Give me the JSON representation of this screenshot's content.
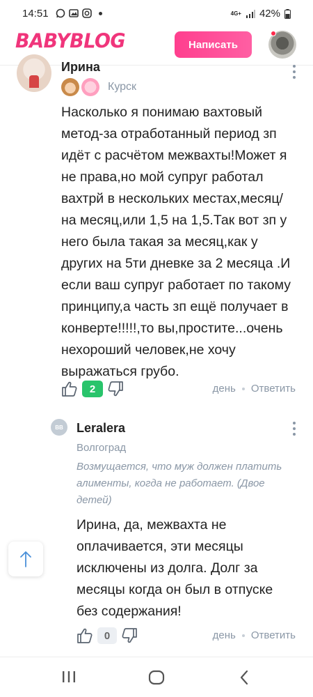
{
  "status_bar": {
    "time": "14:51",
    "network": "4G+",
    "battery": "42%"
  },
  "header": {
    "logo": "BABYBLOG",
    "write_button": "Написать"
  },
  "comment": {
    "author": "Ирина",
    "city": "Курск",
    "text": "Насколько я понимаю вахтовый метод-за отработанный период зп идёт с расчётом межвахты!Может я не права,но мой супруг работал вахтрй в нескольких местах,месяц/на месяц,или 1,5 на 1,5.Так вот зп у него была такая за месяц,как у других на 5ти дневке за 2 месяца .И если ваш супруг работает по такому принципу,а часть зп ещё получает в конверте!!!!!,то вы,простите...очень нехороший человек,не хочу выражаться грубо.",
    "likes": "2",
    "time": "день",
    "reply_label": "Ответить"
  },
  "reply": {
    "avatar_text": "BB",
    "author": "Leralera",
    "city": "Волгоград",
    "status": "Возмущается, что муж должен платить алименты, когда не работает. (Двое детей)",
    "text": "Ирина, да, межвахта не оплачивается, эти месяцы исключены из долга. Долг за месяцы когда он был в отпуске без содержания!",
    "likes": "0",
    "time": "день",
    "reply_label": "Ответить"
  },
  "colors": {
    "brand": "#f0357b",
    "like_badge": "#29c46b",
    "meta_text": "#8a97a6"
  },
  "icons": [
    "whatsapp-icon",
    "gallery-icon",
    "instagram-icon",
    "signal-icon",
    "battery-icon",
    "thumbs-up-icon",
    "thumbs-down-icon",
    "more-vertical-icon",
    "arrow-up-icon",
    "recents-icon",
    "home-icon",
    "back-icon"
  ]
}
